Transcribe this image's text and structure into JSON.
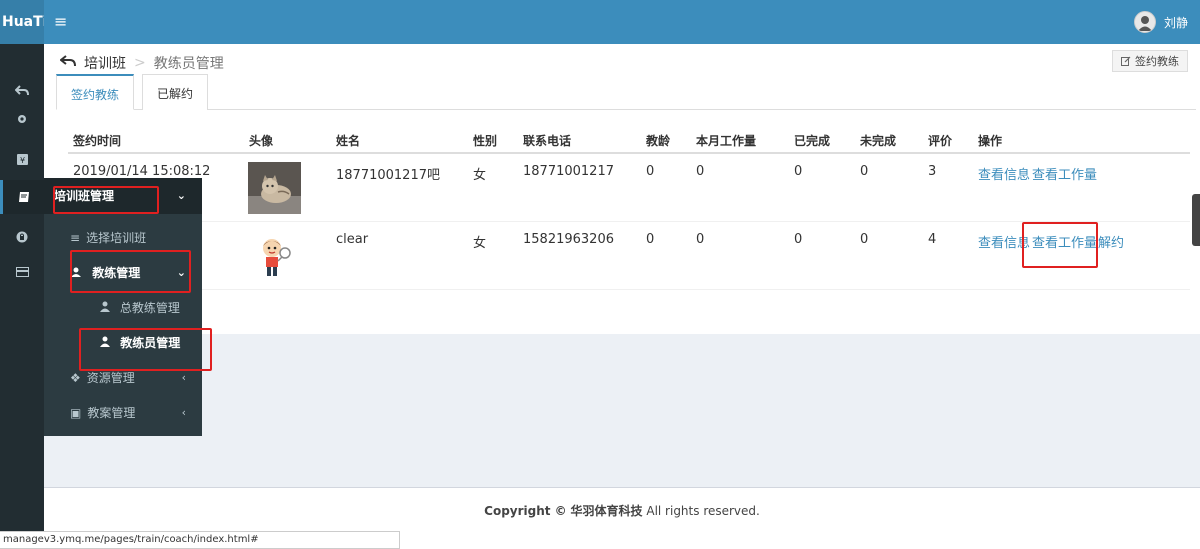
{
  "brand": "HuaTi",
  "user": {
    "name": "刘静"
  },
  "breadcrumb": {
    "main": "培训班",
    "current": "教练员管理"
  },
  "actions": {
    "sign_coach": "签约教练"
  },
  "tabs": [
    {
      "label": "签约教练",
      "active": true
    },
    {
      "label": "已解约",
      "active": false
    }
  ],
  "table": {
    "headers": [
      "签约时间",
      "头像",
      "姓名",
      "性别",
      "联系电话",
      "教龄",
      "本月工作量",
      "已完成",
      "未完成",
      "评价",
      "操作"
    ],
    "rows": [
      {
        "signed_at": "2019/01/14 15:08:12",
        "avatar": "cat-photo",
        "name": "18771001217吧",
        "gender": "女",
        "phone": "18771001217",
        "years": "0",
        "workload": "0",
        "done": "0",
        "undone": "0",
        "rating": "3",
        "op_info": "查看信息",
        "op_workload": "查看工作量",
        "op_cancel": ""
      },
      {
        "signed_at": "",
        "avatar": "cartoon-player",
        "name": "clear",
        "gender": "女",
        "phone": "15821963206",
        "years": "0",
        "workload": "0",
        "done": "0",
        "undone": "0",
        "rating": "4",
        "op_info": "查看信息",
        "op_workload": "查看工作量",
        "op_cancel": "解约"
      }
    ]
  },
  "flyout": {
    "header": "培训班管理",
    "items": [
      {
        "label": "选择培训班",
        "icon": "list-icon"
      },
      {
        "label": "教练管理",
        "icon": "users-icon"
      },
      {
        "label": "总教练管理",
        "icon": "user-tie-icon"
      },
      {
        "label": "教练员管理",
        "icon": "user-icon"
      },
      {
        "label": "资源管理",
        "icon": "cubes-icon"
      },
      {
        "label": "教案管理",
        "icon": "archive-icon"
      }
    ]
  },
  "footer": {
    "copyright": "Copyright ©",
    "company": "华羽体育科技",
    "rights": "All rights reserved."
  },
  "status_url": "managev3.ymq.me/pages/train/coach/index.html#",
  "colors": {
    "topbar": "#3c8dbc",
    "sidebar": "#222d32",
    "link": "#3c8dbc",
    "highlight": "#e02020"
  }
}
